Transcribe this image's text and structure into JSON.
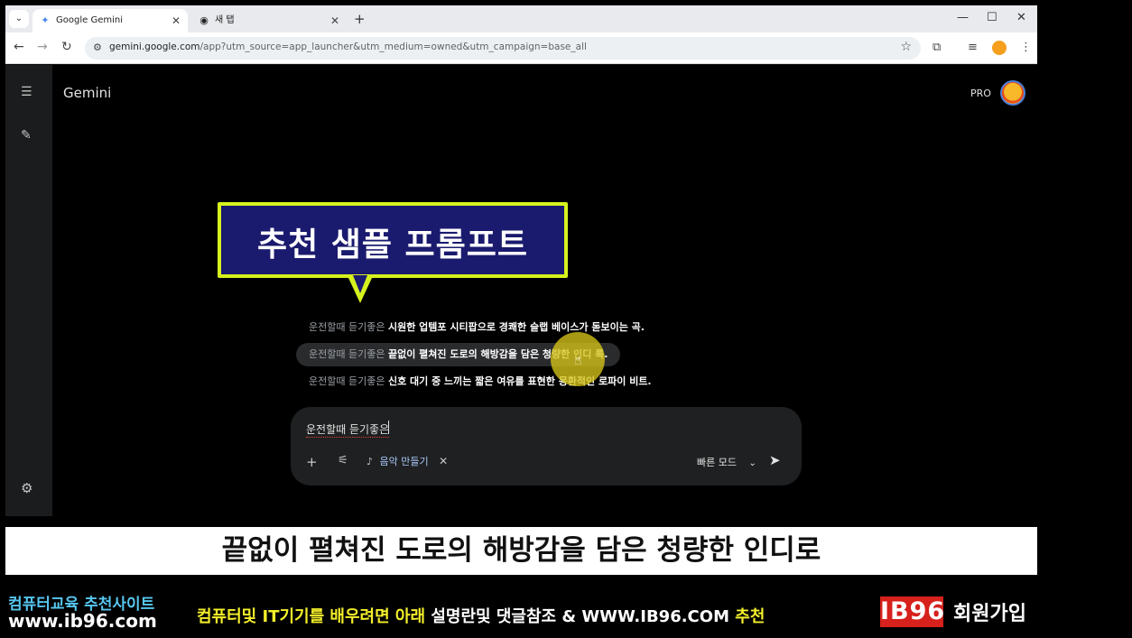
{
  "browser": {
    "tabs": [
      {
        "label": "Google Gemini",
        "active": true
      },
      {
        "label": "새 탭",
        "active": false
      }
    ],
    "url_host": "gemini.google.com",
    "url_path": "/app?utm_source=app_launcher&utm_medium=owned&utm_campaign=base_all"
  },
  "app": {
    "brand": "Gemini",
    "pro_badge": "PRO"
  },
  "callout": {
    "text": "추천 샘플 프롬프트",
    "color_border": "#d6f21e",
    "color_fill": "#1a1a6e"
  },
  "suggestions": [
    {
      "prefix": "운전할때 듣기좋은",
      "text": "시원한 업템포 시티팝으로 경쾌한 슬랩 베이스가 돋보이는 곡."
    },
    {
      "prefix": "운전할때 듣기좋은",
      "text": "끝없이 펼쳐진 도로의 해방감을 담은 청량한 인디 록."
    },
    {
      "prefix": "운전할때 듣기좋은",
      "text": "신호 대기 중 느끼는 짧은 여유를 표현한 몽환적인 로파이 비트."
    }
  ],
  "input": {
    "value": "운전할때 듣기좋은",
    "chip_label": "음악 만들기",
    "mode_label": "빠른 모드"
  },
  "subtitle": "끝없이 펼쳐진 도로의 해방감을 담은 청량한 인디로",
  "footer": {
    "left_line1": "컴퓨터교육 추천사이트",
    "left_line2": "www.ib96.com",
    "mid_part1": "컴퓨터및 IT기기를 배우려면 아래",
    "mid_part2": "설명란및 댓글참조 & WWW.IB96.COM",
    "mid_part3": "추천",
    "logo": "IB96",
    "join": "회원가입"
  }
}
